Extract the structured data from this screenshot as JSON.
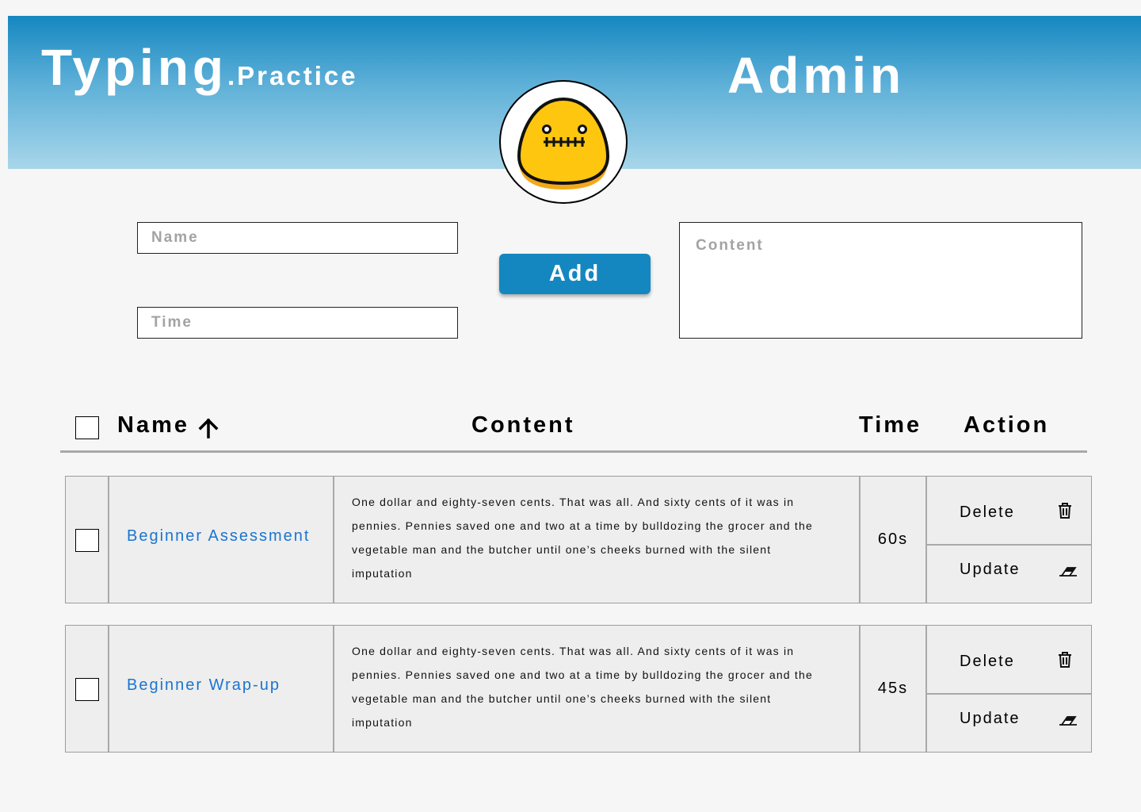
{
  "header": {
    "logo_main": "Typing",
    "logo_sub": ".Practice",
    "admin_title": "Admin",
    "avatar_icon": "yellow-blob-face-icon"
  },
  "form": {
    "name_placeholder": "Name",
    "time_placeholder": "Time",
    "content_placeholder": "Content",
    "add_label": "Add"
  },
  "table": {
    "headers": {
      "name": "Name",
      "content": "Content",
      "time": "Time",
      "action": "Action"
    },
    "sort_icon": "arrow-up-icon",
    "rows": [
      {
        "name": "Beginner Assessment",
        "content": "One dollar and eighty-seven cents. That was all. And sixty cents of it was in pennies. Pennies saved one and two at a time by bulldozing the grocer and the vegetable man and the butcher until one’s cheeks burned with the silent imputation",
        "time": "60s",
        "delete_label": "Delete",
        "update_label": "Update"
      },
      {
        "name": "Beginner Wrap-up",
        "content": "One dollar and eighty-seven cents. That was all. And sixty cents of it was in pennies. Pennies saved one and two at a time by bulldozing the grocer and the vegetable man and the butcher until one’s cheeks burned with the silent imputation",
        "time": "45s",
        "delete_label": "Delete",
        "update_label": "Update"
      }
    ]
  },
  "colors": {
    "header_top": "#1587c0",
    "header_bottom": "#a8d6ea",
    "accent": "#1487c0",
    "link": "#1a75cf",
    "row_bg": "#eeeeee"
  }
}
